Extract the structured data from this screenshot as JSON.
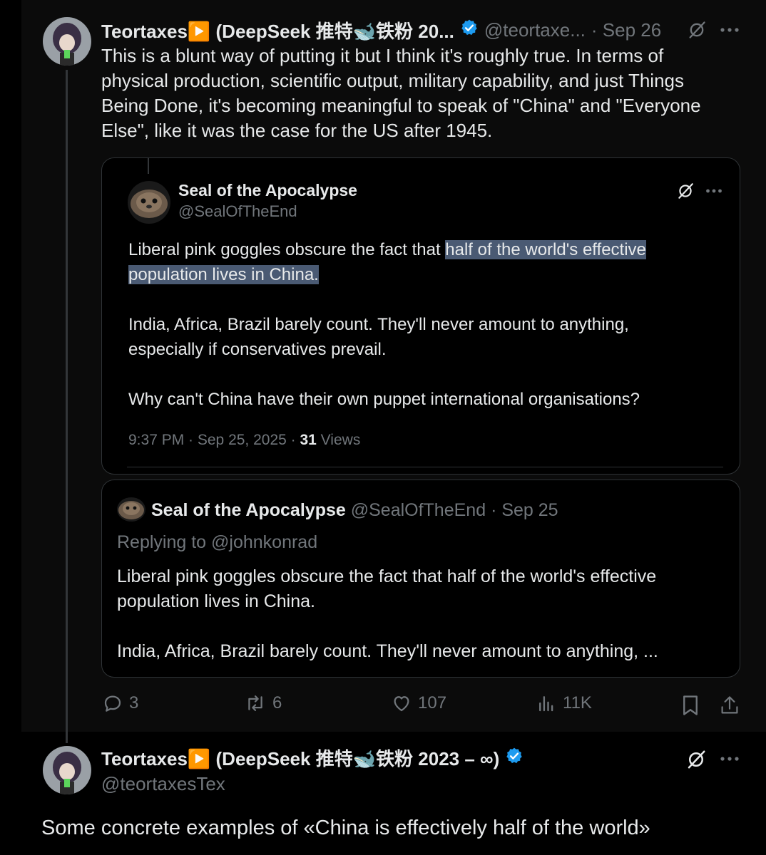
{
  "tweet1": {
    "display_name": "Teortaxes▶️ (DeepSeek 推特🐋铁粉 20...",
    "handle": "@teortaxe...",
    "time": "· Sep 26",
    "text_lines": [
      "This is a blunt way of putting it but I think it's roughly true. In terms of",
      "physical production, scientific output, military capability, and just Things",
      "Being Done, it's becoming meaningful to speak of \"China\" and \"Everyone",
      "Else\", like it was the case for the US after 1945."
    ]
  },
  "quote": {
    "display_name": "Seal of the Apocalypse",
    "handle": "@SealOfTheEnd",
    "line1_prefix": "Liberal pink goggles obscure the fact that ",
    "line1_highlight": "half of the world's effective",
    "line2_highlight": "population lives in China.",
    "para2_lines": [
      "India, Africa, Brazil barely count. They'll never amount to anything,",
      "especially if conservatives prevail."
    ],
    "para3": "Why can't China have their own puppet international organisations?",
    "meta_time": "9:37 PM · Sep 25, 2025 · ",
    "meta_views_count": "31",
    "meta_views_label": " Views"
  },
  "nested": {
    "display_name": "Seal of the Apocalypse",
    "handle": "@SealOfTheEnd",
    "time": "· Sep 25",
    "replying": "Replying to @johnkonrad",
    "lines": [
      "Liberal pink goggles obscure the fact that half of the world's effective",
      "population lives in China.",
      "India, Africa, Brazil barely count. They'll never amount to anything, ..."
    ]
  },
  "actions": {
    "replies": "3",
    "reposts": "6",
    "likes": "107",
    "views": "11K"
  },
  "tweet2": {
    "display_name": "Teortaxes▶️ (DeepSeek 推特🐋铁粉 2023 – ∞)",
    "handle": "@teortaxesTex",
    "text": "Some concrete examples of «China is effectively half of the world»"
  },
  "colors": {
    "background": "#000000",
    "text": "#e7e9ea",
    "muted": "#71767b",
    "verified": "#1d9bf0",
    "highlight": "#4a5a73"
  }
}
